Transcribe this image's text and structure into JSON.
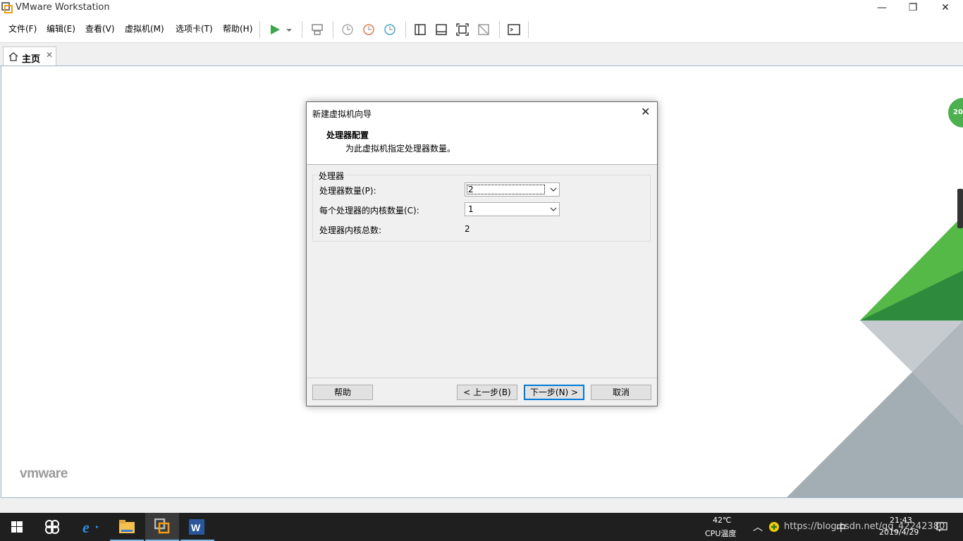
{
  "window": {
    "title": "VMware Workstation",
    "minimize_glyph": "—",
    "restore_glyph": "❐",
    "close_glyph": "✕"
  },
  "menu": {
    "file": "文件(F)",
    "edit": "编辑(E)",
    "view": "查看(V)",
    "vm": "虚拟机(M)",
    "tabs": "选项卡(T)",
    "help": "帮助(H)"
  },
  "toolbar_icons": [
    "play-icon",
    "dropdown-arrow-icon",
    "send-ctrl-alt-del-icon",
    "snapshot-icon",
    "revert-snapshot-icon",
    "snapshot-manager-icon",
    "library-view-icon",
    "thumbnail-view-icon",
    "fullscreen-icon",
    "unity-icon",
    "console-view-icon"
  ],
  "tabs": {
    "home_label": "主页",
    "home_close": "✕"
  },
  "main": {
    "logo_text": "vmware",
    "badge_text": "20"
  },
  "dialog": {
    "title": "新建虚拟机向导",
    "close_glyph": "✕",
    "heading": "处理器配置",
    "description": "为此虚拟机指定处理器数量。",
    "group_label": "处理器",
    "processor_count_label": "处理器数量(P):",
    "processor_count_value": "2",
    "cores_per_processor_label": "每个处理器的内核数量(C):",
    "cores_per_processor_value": "1",
    "total_cores_label": "处理器内核总数:",
    "total_cores_value": "2",
    "buttons": {
      "help": "帮助",
      "back": "< 上一步(B)",
      "next": "下一步(N) >",
      "cancel": "取消"
    }
  },
  "taskbar": {
    "temperature": "42℃",
    "temperature_label": "CPU温度",
    "time": "21:43",
    "date": "2019/4/29",
    "watermark": "https://blog.csdn.net/qq_42242380",
    "ime": "中"
  },
  "colors": {
    "accent_blue": "#0078d7",
    "vmware_green": "#4caf50",
    "vmware_green_dark": "#1e7a34",
    "deco_gray": "#a9b2b8",
    "taskbar_bg": "#1f1f1f"
  }
}
